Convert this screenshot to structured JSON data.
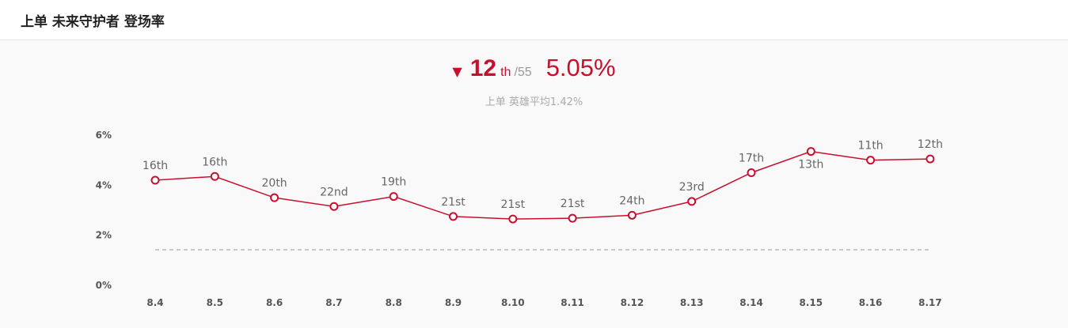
{
  "header": {
    "title": "上单 未来守护者 登场率"
  },
  "summary": {
    "arrow": "▼",
    "rank": "12",
    "rank_suffix": "th",
    "rank_total": "/55",
    "rate": "5.05%",
    "average_text": "上单 英雄平均1.42%"
  },
  "colors": {
    "accent": "#c8102e",
    "average_line": "#aaaaaa"
  },
  "chart_data": {
    "type": "line",
    "categories": [
      "8.4",
      "8.5",
      "8.6",
      "8.7",
      "8.8",
      "8.9",
      "8.10",
      "8.11",
      "8.12",
      "8.13",
      "8.14",
      "8.15",
      "8.16",
      "8.17"
    ],
    "series": [
      {
        "values": [
          4.2,
          4.35,
          3.5,
          3.15,
          3.55,
          2.75,
          2.65,
          2.68,
          2.8,
          3.35,
          4.5,
          5.35,
          5.0,
          5.05
        ],
        "rank_labels": [
          "16th",
          "16th",
          "20th",
          "22nd",
          "19th",
          "21st",
          "21st",
          "21st",
          "24th",
          "23rd",
          "17th",
          "13th",
          "11th",
          "12th"
        ]
      }
    ],
    "average": 1.42,
    "ylim": [
      0,
      6
    ],
    "yticks": [
      0,
      2,
      4,
      6
    ],
    "ytick_labels": [
      "0%",
      "2%",
      "4%",
      "6%"
    ],
    "grid": false,
    "legend": "none"
  }
}
